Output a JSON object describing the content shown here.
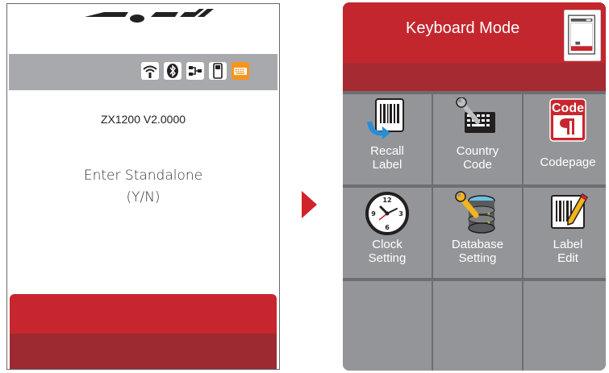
{
  "left_screen": {
    "model": "ZX1200 V2.0000",
    "prompt_line1": "Enter Standalone",
    "prompt_line2": "(Y/N)",
    "status_icons": [
      "wifi-icon",
      "bluetooth-icon",
      "network-icon",
      "usb-drive-icon",
      "keyboard-icon"
    ]
  },
  "right_screen": {
    "title": "Keyboard Mode",
    "tiles": [
      {
        "line1": "Recall",
        "line2": "Label",
        "icon": "barcode-recall-icon"
      },
      {
        "line1": "Country",
        "line2": "Code",
        "icon": "keyboard-wrench-icon"
      },
      {
        "line1": "Codepage",
        "line2": "",
        "icon": "codepage-icon"
      },
      {
        "line1": "Clock",
        "line2": "Setting",
        "icon": "clock-icon"
      },
      {
        "line1": "Database",
        "line2": "Setting",
        "icon": "database-wrench-icon"
      },
      {
        "line1": "Label",
        "line2": "Edit",
        "icon": "label-edit-icon"
      },
      {
        "line1": "",
        "line2": "",
        "icon": ""
      },
      {
        "line1": "",
        "line2": "",
        "icon": ""
      },
      {
        "line1": "",
        "line2": "",
        "icon": ""
      }
    ],
    "code_badge_text": "Code"
  },
  "colors": {
    "accent_red": "#c8262e",
    "dark_red": "#9d2a30",
    "tile_gray": "#939598",
    "status_gray": "#a7a9ac"
  }
}
